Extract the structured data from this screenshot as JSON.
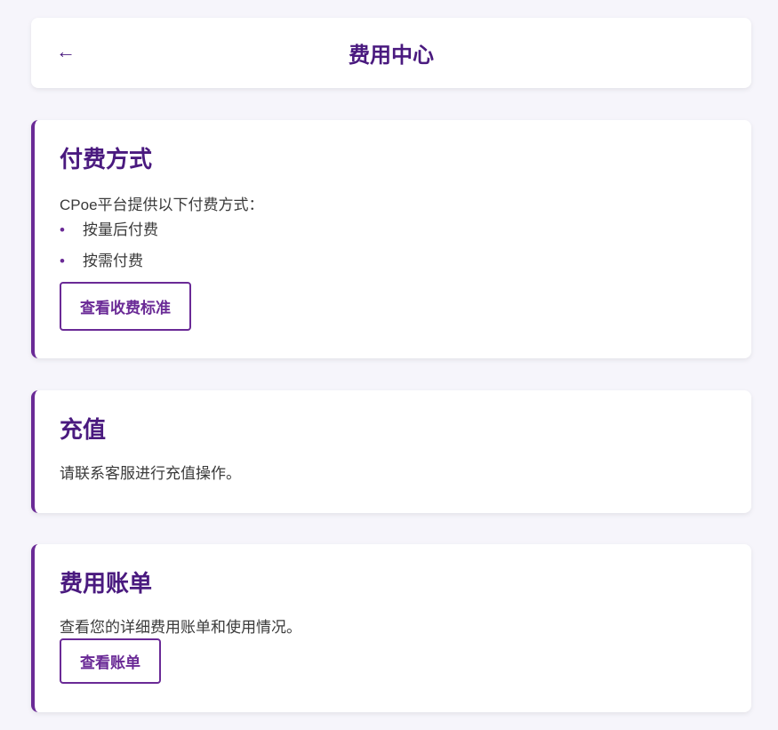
{
  "header": {
    "title": "费用中心",
    "back_icon": "arrow-left-icon"
  },
  "payment": {
    "title": "付费方式",
    "intro": "CPoe平台提供以下付费方式：",
    "items": [
      "按量后付费",
      "按需付费"
    ],
    "button": "查看收费标准"
  },
  "recharge": {
    "title": "充值",
    "text": "请联系客服进行充值操作。"
  },
  "billing": {
    "title": "费用账单",
    "text": "查看您的详细费用账单和使用情况。",
    "button": "查看账单"
  },
  "colors": {
    "accent": "#6a2a96",
    "title": "#4a1a7f",
    "background": "#f6f5fb"
  }
}
